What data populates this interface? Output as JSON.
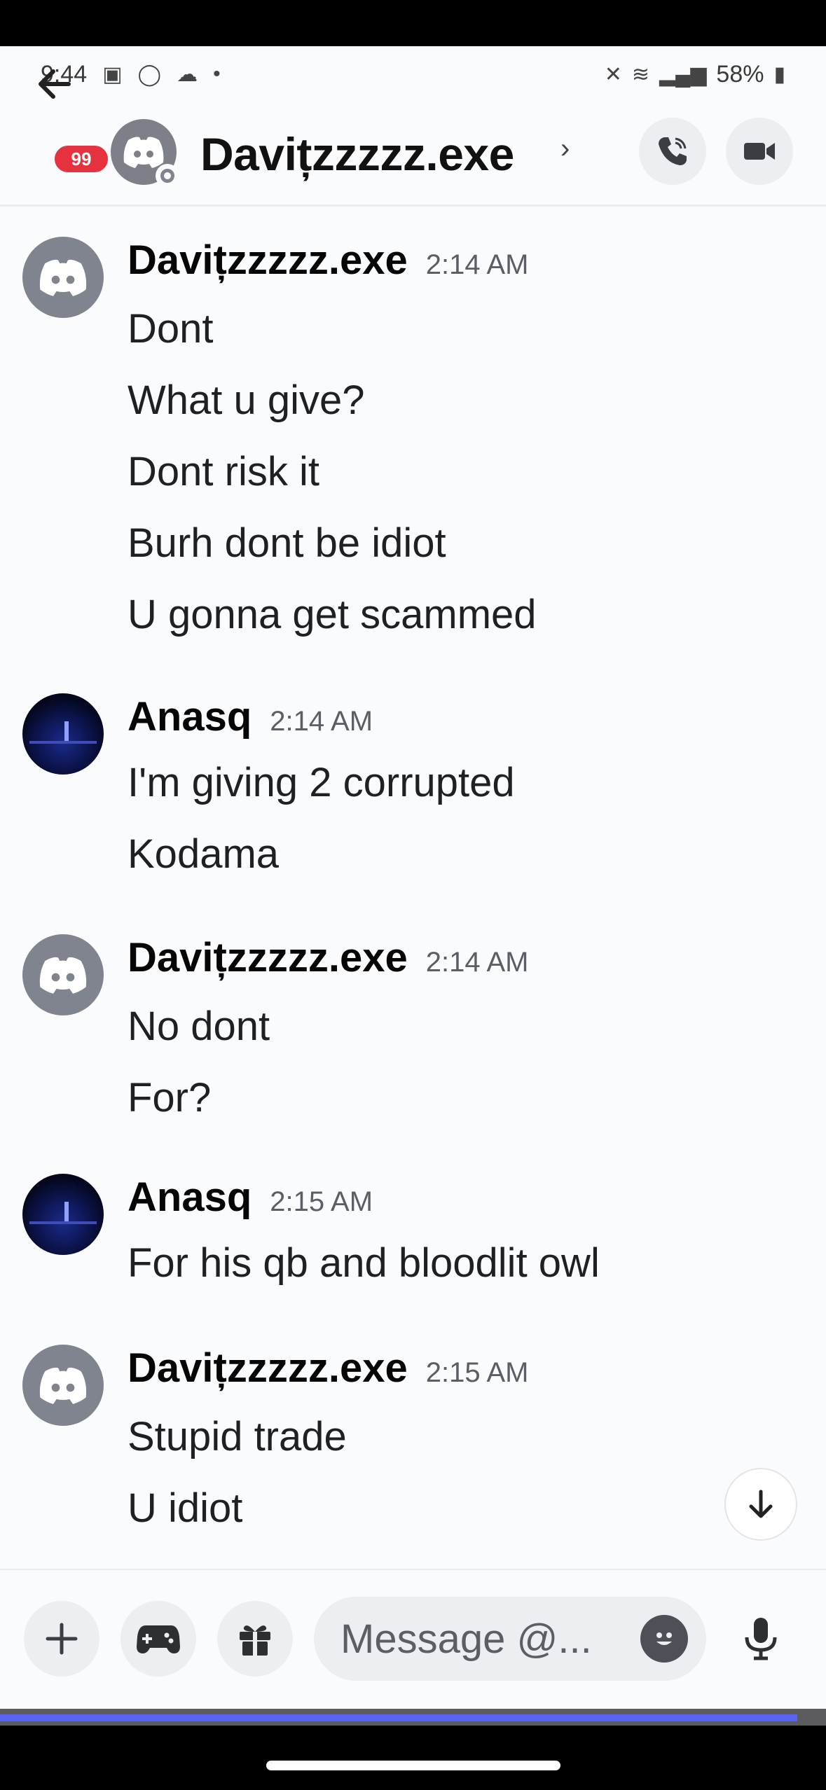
{
  "status_bar": {
    "time": "9:44",
    "battery": "58%"
  },
  "header": {
    "unread_badge": "99",
    "title": "Davițzzzzz.exe",
    "chevron": "›"
  },
  "messages": [
    {
      "author": "Davițzzzzz.exe",
      "time": "2:14 AM",
      "avatar": "discord-default",
      "lines": [
        "Dont",
        "What u give?",
        "Dont risk it",
        "Burh dont be idiot",
        "U gonna get scammed"
      ]
    },
    {
      "author": "Anasq",
      "time": "2:14 AM",
      "avatar": "photo",
      "lines": [
        "I'm giving 2 corrupted",
        "Kodama"
      ]
    },
    {
      "author": "Davițzzzzz.exe",
      "time": "2:14 AM",
      "avatar": "discord-default",
      "lines": [
        "No dont",
        "For?"
      ]
    },
    {
      "author": "Anasq",
      "time": "2:15 AM",
      "avatar": "photo",
      "lines": [
        "For his qb and bloodlit owl"
      ]
    },
    {
      "author": "Davițzzzzz.exe",
      "time": "2:15 AM",
      "avatar": "discord-default",
      "lines": [
        "Stupid trade",
        "U idiot"
      ]
    }
  ],
  "composer": {
    "placeholder": "Message @..."
  },
  "video_progress": 0.965,
  "colors": {
    "accent": "#5865f2",
    "badge": "#e5323e",
    "default_avatar": "#80848e"
  }
}
